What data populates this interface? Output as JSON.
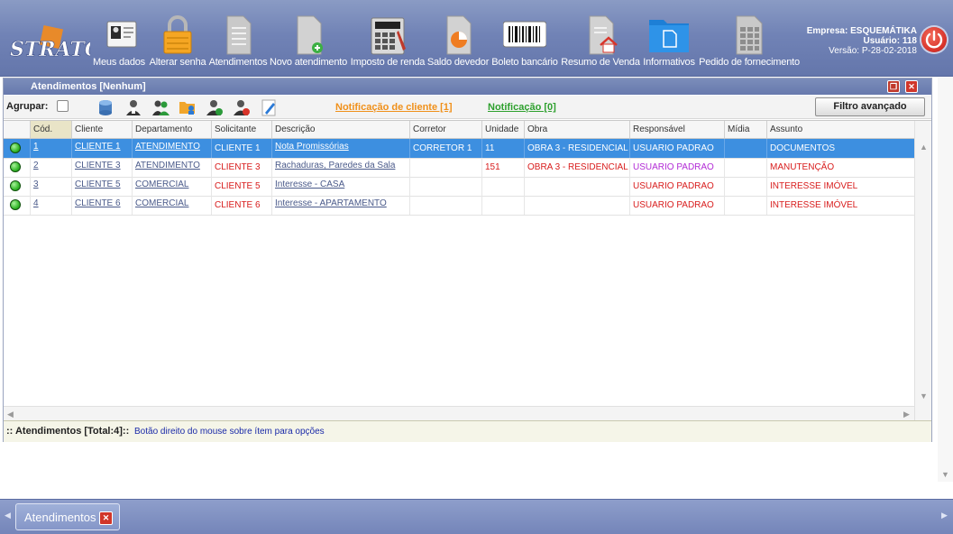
{
  "app": {
    "logo_text": "STRATO"
  },
  "toolbar": {
    "items": [
      {
        "label": "Meus dados",
        "icon": "id-card-icon"
      },
      {
        "label": "Alterar senha",
        "icon": "padlock-icon"
      },
      {
        "label": "Atendimentos",
        "icon": "document-icon"
      },
      {
        "label": "Novo atendimento",
        "icon": "new-document-icon"
      },
      {
        "label": "Imposto de renda",
        "icon": "calculator-icon"
      },
      {
        "label": "Saldo devedor",
        "icon": "pie-report-icon"
      },
      {
        "label": "Boleto bancário",
        "icon": "barcode-icon"
      },
      {
        "label": "Resumo de Venda",
        "icon": "house-document-icon"
      },
      {
        "label": "Informativos",
        "icon": "folder-icon"
      },
      {
        "label": "Pedido de fornecimento",
        "icon": "spreadsheet-icon"
      }
    ]
  },
  "company": {
    "empresa": "Empresa: ESQUEMÁTIKA",
    "usuario": "Usuário: 118",
    "versao": "Versão: P-28-02-2018"
  },
  "window": {
    "title": "Atendimentos [Nenhum]",
    "group_label": "Agrupar:",
    "notif_client": "Notificação de cliente [1]",
    "notif": "Notificação [0]",
    "filter_button": "Filtro avançado"
  },
  "grid": {
    "columns": [
      "Cód.",
      "Cliente",
      "Departamento",
      "Solicitante",
      "Descrição",
      "Corretor",
      "Unidade",
      "Obra",
      "Responsável",
      "Mídia",
      "Assunto"
    ],
    "rows": [
      {
        "cod": "1",
        "cliente": "CLIENTE 1",
        "departamento": "ATENDIMENTO",
        "solicitante": "CLIENTE 1",
        "descricao": "Nota Promissórias",
        "corretor": "CORRETOR 1",
        "unidade": "11",
        "obra": "OBRA 3 - RESIDENCIAL",
        "responsavel": "USUARIO PADRAO",
        "midia": "",
        "assunto": "DOCUMENTOS"
      },
      {
        "cod": "2",
        "cliente": "CLIENTE 3",
        "departamento": "ATENDIMENTO",
        "solicitante": "CLIENTE 3",
        "descricao": "Rachaduras, Paredes da Sala",
        "corretor": "",
        "unidade": "151",
        "obra": "OBRA 3 - RESIDENCIAL",
        "responsavel": "USUARIO PADRAO",
        "midia": "",
        "assunto": "MANUTENÇÃO"
      },
      {
        "cod": "3",
        "cliente": "CLIENTE 5",
        "departamento": "COMERCIAL",
        "solicitante": "CLIENTE 5",
        "descricao": "Interesse - CASA",
        "corretor": "",
        "unidade": "",
        "obra": "",
        "responsavel": "USUARIO PADRAO",
        "midia": "",
        "assunto": "INTERESSE IMÓVEL"
      },
      {
        "cod": "4",
        "cliente": "CLIENTE 6",
        "departamento": "COMERCIAL",
        "solicitante": "CLIENTE 6",
        "descricao": "Interesse - APARTAMENTO",
        "corretor": "",
        "unidade": "",
        "obra": "",
        "responsavel": "USUARIO PADRAO",
        "midia": "",
        "assunto": "INTERESSE IMÓVEL"
      }
    ]
  },
  "status": {
    "total": ":: Atendimentos [Total:4]::",
    "hint": "Botão direito do mouse sobre ítem para opções"
  },
  "taskbar": {
    "tab_label": "Atendimentos"
  },
  "colors": {
    "selected_row": "#3d8fe0",
    "toolbar_bg": "#7183b6",
    "notif_client": "#f0901a",
    "notif": "#2ea02e"
  }
}
